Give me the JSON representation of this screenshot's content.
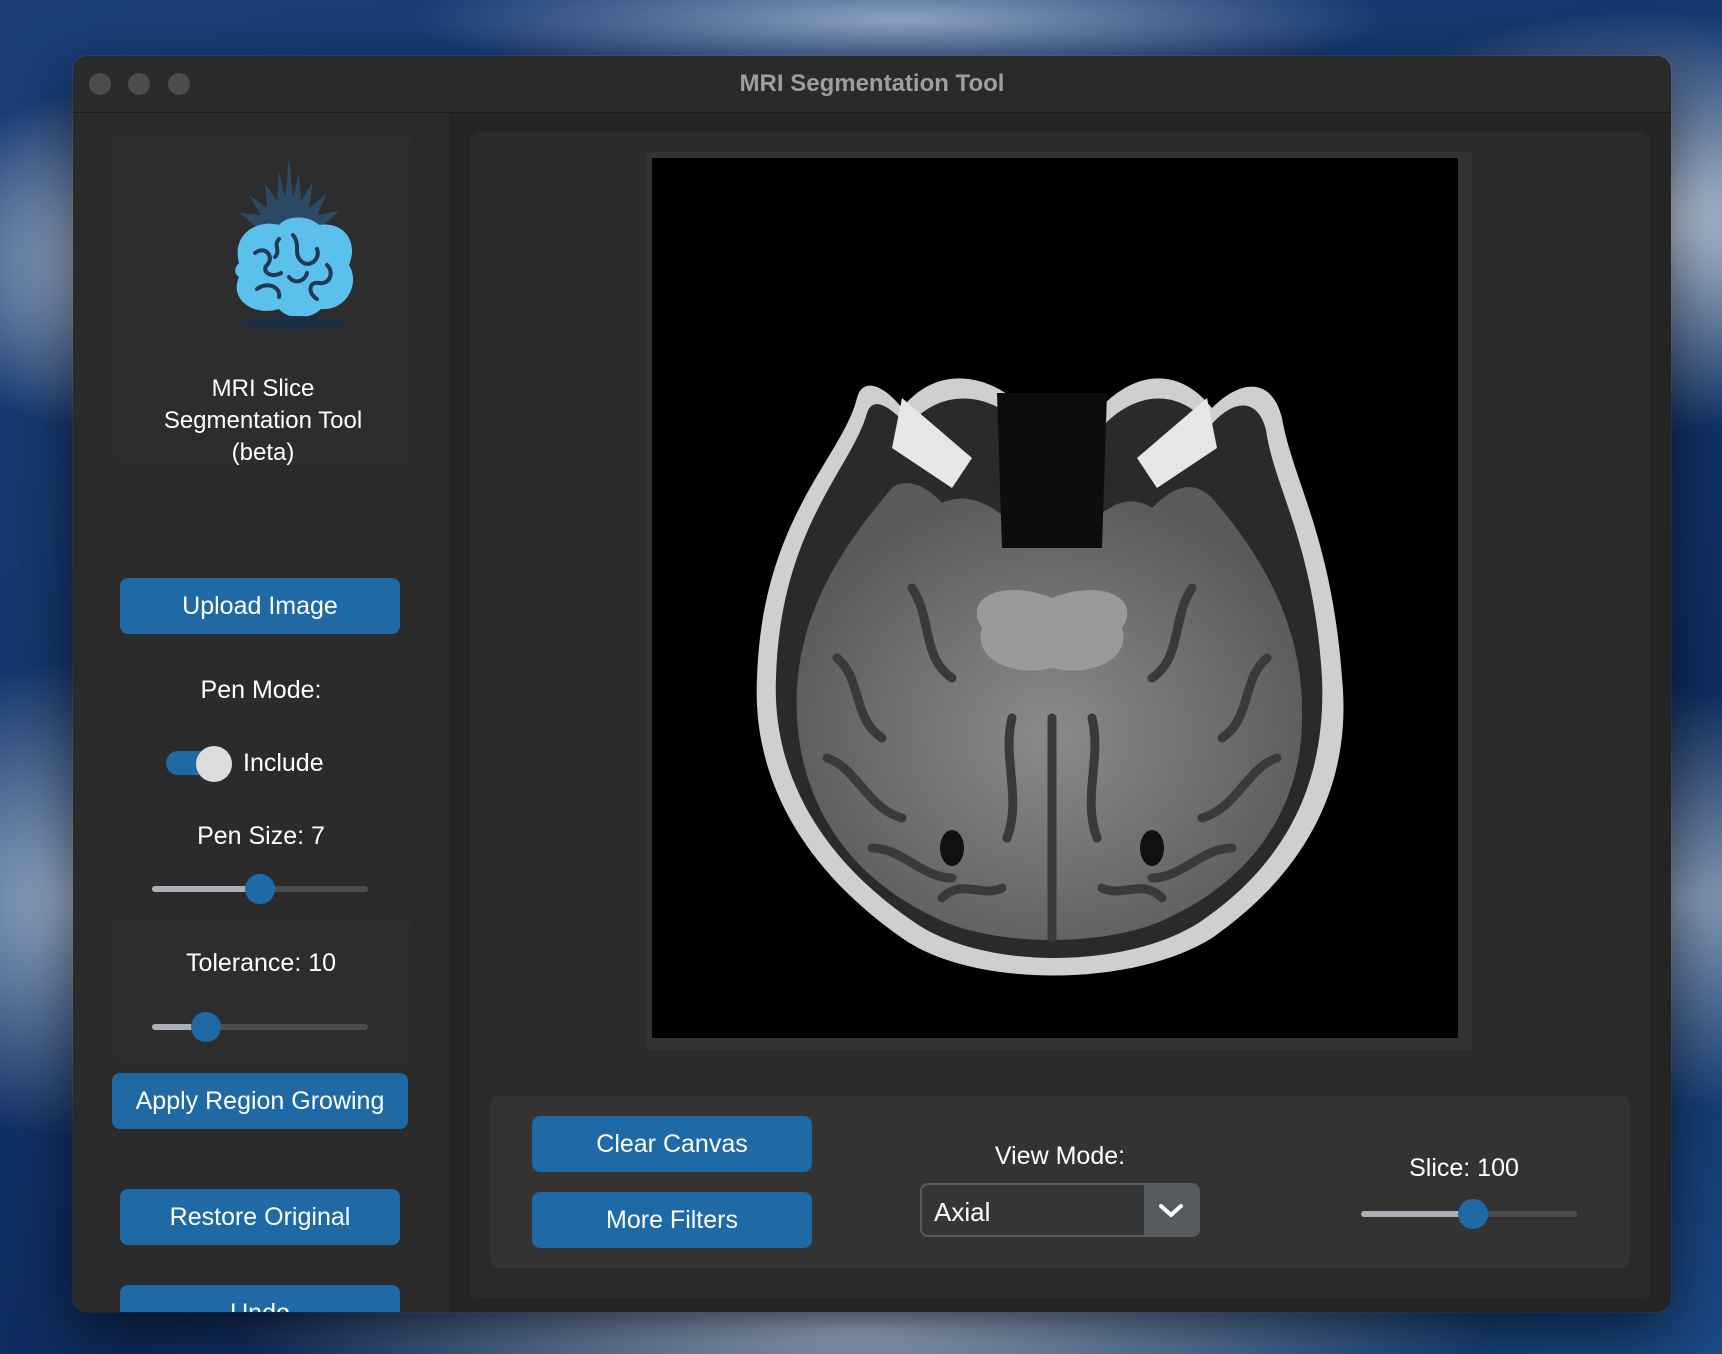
{
  "window": {
    "title": "MRI Segmentation Tool"
  },
  "sidebar": {
    "logo_icon": "brain-icon",
    "app_title_lines": [
      "MRI Slice",
      "Segmentation Tool",
      "(beta)"
    ],
    "upload_label": "Upload Image",
    "pen_mode_label": "Pen Mode:",
    "pen_mode_value": "Include",
    "pen_mode_on": true,
    "pen_size_label": "Pen Size: 7",
    "pen_size_fraction": 0.5,
    "tolerance_label": "Tolerance: 10",
    "tolerance_fraction": 0.25,
    "apply_label": "Apply Region Growing",
    "restore_label": "Restore Original",
    "undo_label": "Undo"
  },
  "main": {
    "image_alt": "mri-axial-slice",
    "clear_label": "Clear Canvas",
    "filters_label": "More Filters",
    "view_mode_label": "View Mode:",
    "view_mode_value": "Axial",
    "slice_label": "Slice: 100",
    "slice_fraction": 0.52
  },
  "colors": {
    "accent": "#1f6aa5",
    "window_bg": "#242424",
    "panel_bg": "#2b2b2b",
    "logo": "#5bc0eb"
  }
}
